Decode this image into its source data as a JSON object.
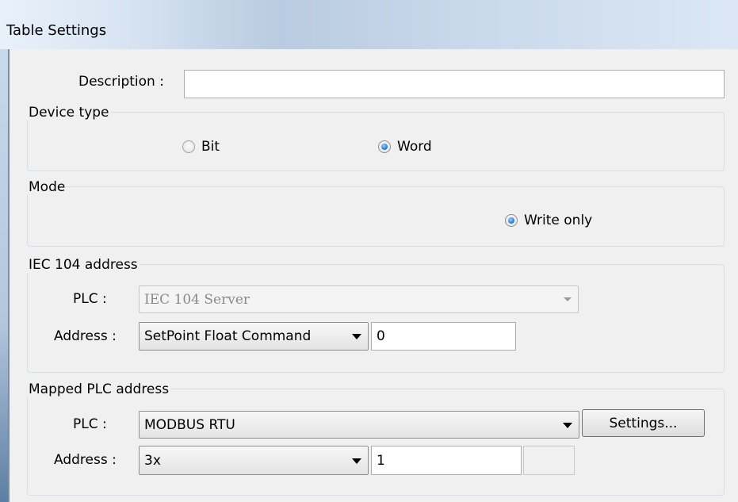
{
  "window": {
    "title": "Table Settings"
  },
  "description": {
    "label": "Description :",
    "value": ""
  },
  "device_type": {
    "group_title": "Device type",
    "options": [
      {
        "label": "Bit",
        "selected": false
      },
      {
        "label": "Word",
        "selected": true
      }
    ]
  },
  "mode": {
    "group_title": "Mode",
    "options": [
      {
        "label": "Write only",
        "selected": true
      }
    ]
  },
  "iec104_address": {
    "group_title": "IEC 104 address",
    "plc_label": "PLC :",
    "plc_value": "IEC 104 Server",
    "address_label": "Address :",
    "address_type": "SetPoint Float Command",
    "address_value": "0"
  },
  "mapped_plc_address": {
    "group_title": "Mapped PLC address",
    "plc_label": "PLC :",
    "plc_value": "MODBUS RTU",
    "settings_button": "Settings...",
    "address_label": "Address :",
    "address_type": "3x",
    "address_value": "1",
    "extra_value": ""
  },
  "colors": {
    "window_bg": "#f0f0f0",
    "radio_selected": "#2a7fd4",
    "titlebar_gradient": "#b9cbe0"
  }
}
